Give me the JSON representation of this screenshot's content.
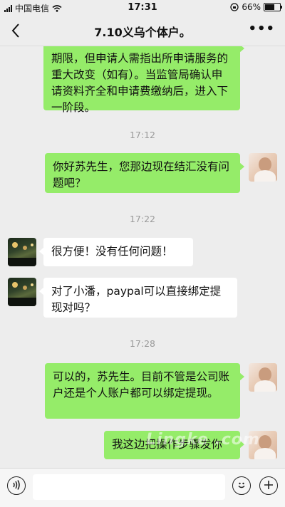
{
  "status_bar": {
    "carrier": "中国电信",
    "time": "17:31",
    "battery_text": "66%",
    "battery_level": 0.66
  },
  "nav": {
    "back_glyph": "‹",
    "title": "7.10义乌个体户。",
    "more_glyph": "•••"
  },
  "messages": [
    {
      "type": "out",
      "text": "期限，但申请人需指出所申请服务的重大改变（如有）。当监管局确认申请资料齐全和申请费缴纳后，进入下一阶段。"
    },
    {
      "type": "time",
      "text": "17:12"
    },
    {
      "type": "out",
      "text": "你好苏先生，您那边现在结汇没有问题吧？"
    },
    {
      "type": "time",
      "text": "17:22"
    },
    {
      "type": "in",
      "text": "很方便！没有任何问题！"
    },
    {
      "type": "in",
      "text": "对了小潘，paypal可以直接绑定提现对吗？"
    },
    {
      "type": "time",
      "text": "17:28"
    },
    {
      "type": "out",
      "text": "可以的，苏先生。目前不管是公司账户还是个人账户都可以绑定提现。"
    },
    {
      "type": "out",
      "text": "我这边把操作步骤发你"
    }
  ],
  "bottom_bar": {
    "voice_icon": "voice-icon",
    "emoji_icon": "emoji-icon",
    "plus_icon": "plus-icon"
  },
  "watermark": "Lingke .com"
}
